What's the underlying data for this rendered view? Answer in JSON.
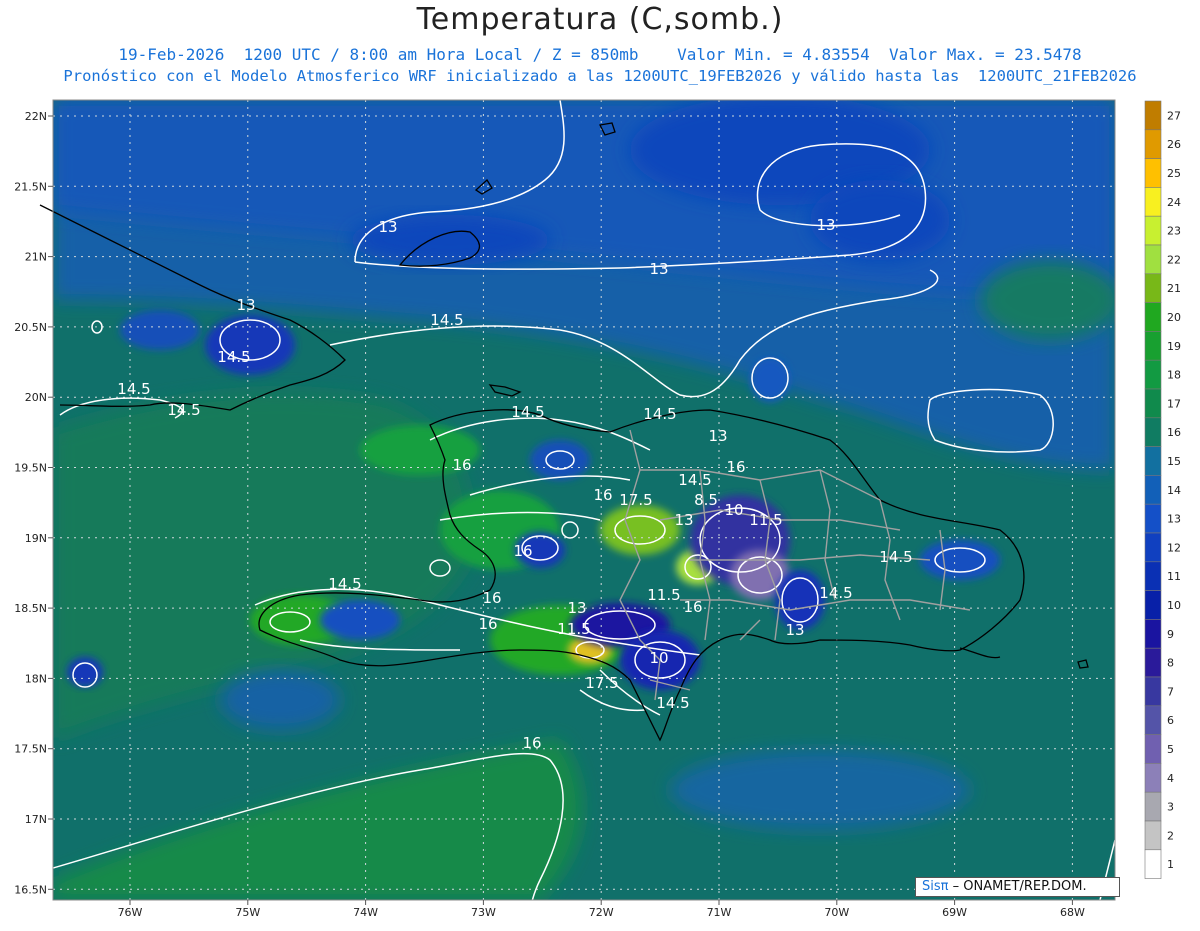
{
  "header": {
    "title": "Temperatura (C,somb.)",
    "line1": "19-Feb-2026  1200 UTC / 8:00 am Hora Local / Z = 850mb    Valor Min. = 4.83554  Valor Max. = 23.5478",
    "line2": "Pronóstico con el Modelo Atmosferico WRF inicializado a las 1200UTC_19FEB2026 y válido hasta las  1200UTC_21FEB2026"
  },
  "map": {
    "lat_labels": [
      "22N",
      "21.5N",
      "21N",
      "20.5N",
      "20N",
      "19.5N",
      "19N",
      "18.5N",
      "18N",
      "17.5N",
      "17N",
      "16.5N"
    ],
    "lon_labels": [
      "76W",
      "75W",
      "74W",
      "73W",
      "72W",
      "71W",
      "70W",
      "69W",
      "68W"
    ],
    "contour_labels": [
      {
        "text": "13"
      },
      {
        "text": "13"
      },
      {
        "text": "13"
      },
      {
        "text": "13"
      },
      {
        "text": "14.5"
      },
      {
        "text": "14.5"
      },
      {
        "text": "14.5"
      },
      {
        "text": "14.5"
      },
      {
        "text": "14.5"
      },
      {
        "text": "14.5"
      },
      {
        "text": "13"
      },
      {
        "text": "16"
      },
      {
        "text": "16"
      },
      {
        "text": "14.5"
      },
      {
        "text": "16"
      },
      {
        "text": "17.5"
      },
      {
        "text": "8.5"
      },
      {
        "text": "10"
      },
      {
        "text": "11.5"
      },
      {
        "text": "13"
      },
      {
        "text": "16"
      },
      {
        "text": "14.5"
      },
      {
        "text": "14.5"
      },
      {
        "text": "11.5"
      },
      {
        "text": "16"
      },
      {
        "text": "14.5"
      },
      {
        "text": "16"
      },
      {
        "text": "16"
      },
      {
        "text": "13"
      },
      {
        "text": "11.5"
      },
      {
        "text": "10"
      },
      {
        "text": "17.5"
      },
      {
        "text": "14.5"
      },
      {
        "text": "13"
      },
      {
        "text": "16"
      }
    ],
    "credit_prefix": "Sisπ",
    "credit_text": " – ONAMET/REP.DOM."
  },
  "colorbar": {
    "labels": [
      "27",
      "26",
      "25",
      "24",
      "23",
      "22",
      "21",
      "20",
      "19",
      "18",
      "17",
      "16",
      "15",
      "14",
      "13",
      "12",
      "11",
      "10",
      "9",
      "8",
      "7",
      "6",
      "5",
      "4",
      "3",
      "2",
      "1"
    ],
    "colors": [
      "#c07d00",
      "#e09a00",
      "#ffc000",
      "#f8f020",
      "#c8f030",
      "#a0e040",
      "#78b818",
      "#20a820",
      "#18a030",
      "#129a42",
      "#108a4c",
      "#107c62",
      "#1270a0",
      "#1260b8",
      "#1450c8",
      "#1040c0",
      "#0a30b4",
      "#0820a8",
      "#1a14a0",
      "#2a1a9a",
      "#3838a0",
      "#5454a8",
      "#7060b0",
      "#8c80b8",
      "#a8a8b0",
      "#c4c4c4",
      "#ffffff"
    ]
  }
}
